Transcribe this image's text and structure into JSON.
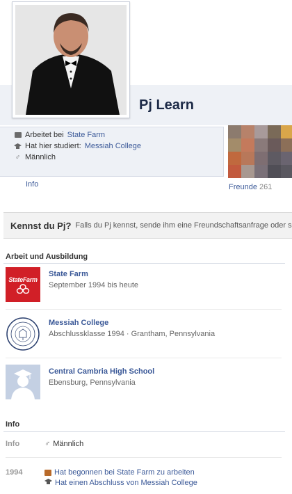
{
  "profile": {
    "name": "Pj Learn",
    "about": {
      "works_prefix": "Arbeitet bei",
      "works_link": "State Farm",
      "studied_prefix": "Hat hier studiert:",
      "studied_link": "Messiah College",
      "gender": "Männlich"
    },
    "info_link": "Info",
    "friends": {
      "label": "Freunde",
      "count": "261"
    }
  },
  "know_bar": {
    "title": "Kennst du Pj?",
    "text_before": "Falls du Pj kennst,",
    "link": "sende ihm eine Freundschaftsanfrage",
    "text_after": "oder sc"
  },
  "work_education": {
    "title": "Arbeit und Ausbildung",
    "items": [
      {
        "title": "State Farm",
        "sub": "September 1994 bis heute",
        "logo": "state-farm-logo",
        "logo_text": "StateFarm"
      },
      {
        "title": "Messiah College",
        "sub": "Abschlussklasse 1994 · Grantham, Pennsylvania",
        "logo": "messiah-college-seal"
      },
      {
        "title": "Central Cambria High School",
        "sub": "Ebensburg, Pennsylvania",
        "logo": "graduate-silhouette"
      }
    ]
  },
  "info_section": {
    "title": "Info",
    "rows": [
      {
        "label": "Info",
        "value": "Männlich"
      }
    ],
    "year": {
      "label": "1994",
      "events": [
        "Hat begonnen bei State Farm zu arbeiten",
        "Hat einen Abschluss von Messiah College"
      ]
    }
  },
  "colors": {
    "link": "#3b5998",
    "brand_red": "#d11f27",
    "friend_tiles": [
      "#8c7b6e",
      "#b7826a",
      "#a89a9a",
      "#7a6a58",
      "#d9a64a",
      "#a38c6a",
      "#c47a5c",
      "#8a7a7a",
      "#6a5a5a",
      "#8c6f58",
      "#c0693e",
      "#b8785a",
      "#7e6e72",
      "#5e5a62",
      "#6a6470",
      "#c25a3e",
      "#a89890",
      "#7a7078",
      "#504e56",
      "#5a5860"
    ]
  },
  "icons": [
    "briefcase-icon",
    "graduation-cap-icon",
    "male-icon",
    "work-event-icon",
    "education-event-icon"
  ]
}
